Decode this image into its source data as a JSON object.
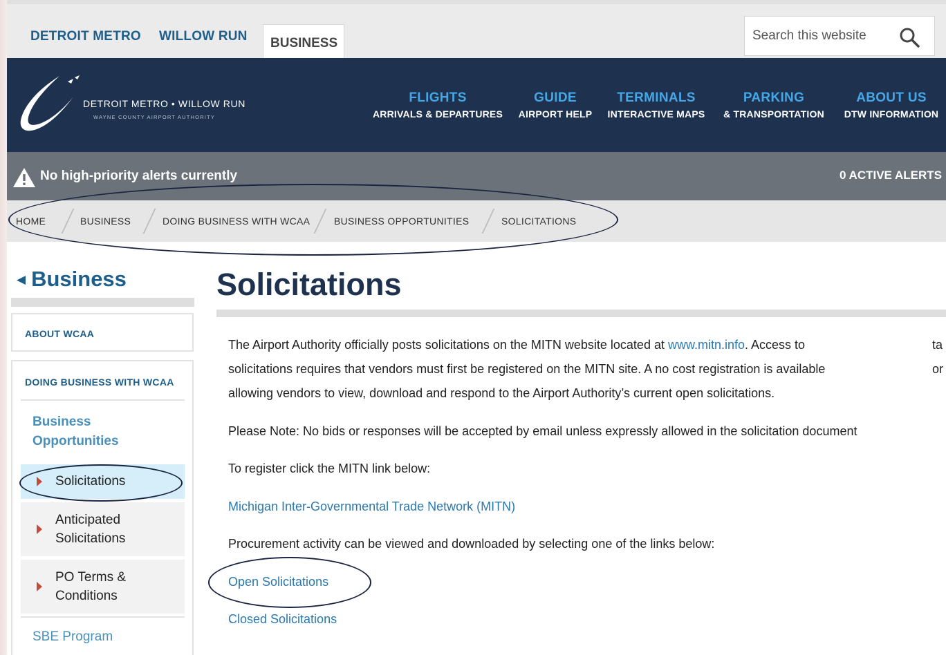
{
  "topbar": {
    "links": [
      "DETROIT METRO",
      "WILLOW RUN"
    ],
    "active_tab": "BUSINESS",
    "search_placeholder": "Search this website"
  },
  "brand": {
    "name": "DETROIT METRO • WILLOW RUN",
    "subtitle": "WAYNE COUNTY AIRPORT AUTHORITY"
  },
  "nav": [
    {
      "title": "FLIGHTS",
      "sub": "ARRIVALS & DEPARTURES"
    },
    {
      "title": "GUIDE",
      "sub": "AIRPORT HELP"
    },
    {
      "title": "TERMINALS",
      "sub": "INTERACTIVE MAPS"
    },
    {
      "title": "PARKING",
      "sub": "& TRANSPORTATION"
    },
    {
      "title": "ABOUT US",
      "sub": "DTW INFORMATION"
    }
  ],
  "alerts": {
    "message": "No high-priority alerts currently",
    "count_label": "0 ACTIVE ALERTS"
  },
  "breadcrumb": [
    "HOME",
    "BUSINESS",
    "DOING BUSINESS WITH WCAA",
    "BUSINESS OPPORTUNITIES",
    "SOLICITATIONS"
  ],
  "sidebar": {
    "title": "Business",
    "about": "ABOUT WCAA",
    "doing_business": "DOING BUSINESS WITH WCAA",
    "sub_section": "Business Opportunities",
    "items": [
      "Solicitations",
      "Anticipated Solicitations",
      "PO Terms & Conditions"
    ],
    "sbe": "SBE Program"
  },
  "content": {
    "title": "Solicitations",
    "para1_a": "The Airport Authority officially posts solicitations on the MITN website located at ",
    "para1_link": "www.mitn.info",
    "para1_b": ". Access to",
    "para1_line2": "solicitations requires that vendors must first be registered on the MITN site. A no cost registration is available",
    "para1_line3": "allowing vendors to view, download and respond to the Airport Authority’s current open solicitations.",
    "trail1": "ta",
    "trail2": "or",
    "note": "Please Note: No bids or responses will be accepted by email unless expressly allowed in the solicitation document",
    "register": "To register click the MITN link below:",
    "mitn_link": "Michigan Inter-Governmental Trade Network (MITN)",
    "procurement": "Procurement activity can be viewed and downloaded by selecting one of the links below:",
    "open_link": "Open Solicitations",
    "closed_link": "Closed Solicitations"
  },
  "colors": {
    "navy": "#1e3250",
    "nav_accent": "#45a7e6",
    "link": "#2b78ad",
    "alert_bar": "#6b7279",
    "active_item": "#d6eef9",
    "marker": "#c24b3a"
  }
}
